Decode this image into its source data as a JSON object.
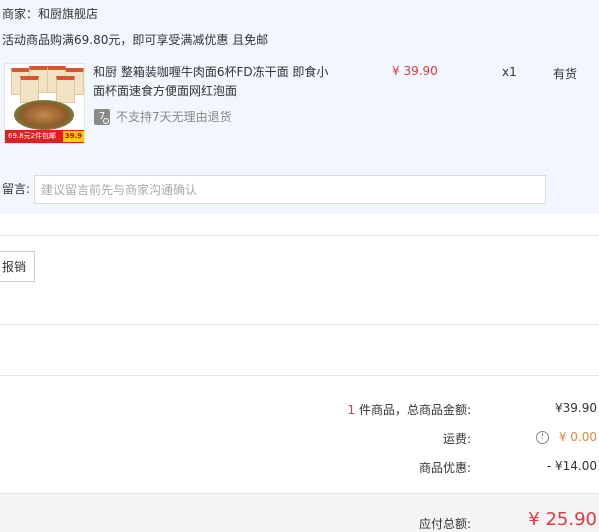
{
  "order": {
    "merchant": "商家：和厨旗舰店",
    "promo": "活动商品购满69.80元，即可享受满减优惠 且免邮",
    "product": {
      "title": "和厨 整箱装咖喱牛肉面6杯FD冻干面 即食小面杯面速食方便面网红泡面",
      "thumb_banner": "69.8元2件包邮",
      "thumb_price": "39.9",
      "return_icon": "7",
      "return_policy": "不支持7天无理由退货",
      "unit_price": "¥ 39.90",
      "quantity": "x1",
      "stock": "有货"
    },
    "remark": {
      "label": "留言:",
      "placeholder": "建议留言前先与商家沟通确认"
    }
  },
  "invoice": {
    "reimburse_label": "报销"
  },
  "summary": {
    "count": "1",
    "items_label": " 件商品，总商品金额:",
    "items_total": "¥39.90",
    "freight_label": "运费:",
    "freight_value": "¥ 0.00",
    "discount_label": "商品优惠:",
    "discount_value": "- ¥14.00",
    "total_label": "应付总额:",
    "total_value": "¥ 25.90"
  },
  "colors": {
    "accent_red": "#e4393c",
    "freight_orange": "#e4893c",
    "order_block_bg": "#f2f7ff"
  },
  "icons": {
    "return": "no-return-icon",
    "freight_info": "info-circle-icon"
  }
}
